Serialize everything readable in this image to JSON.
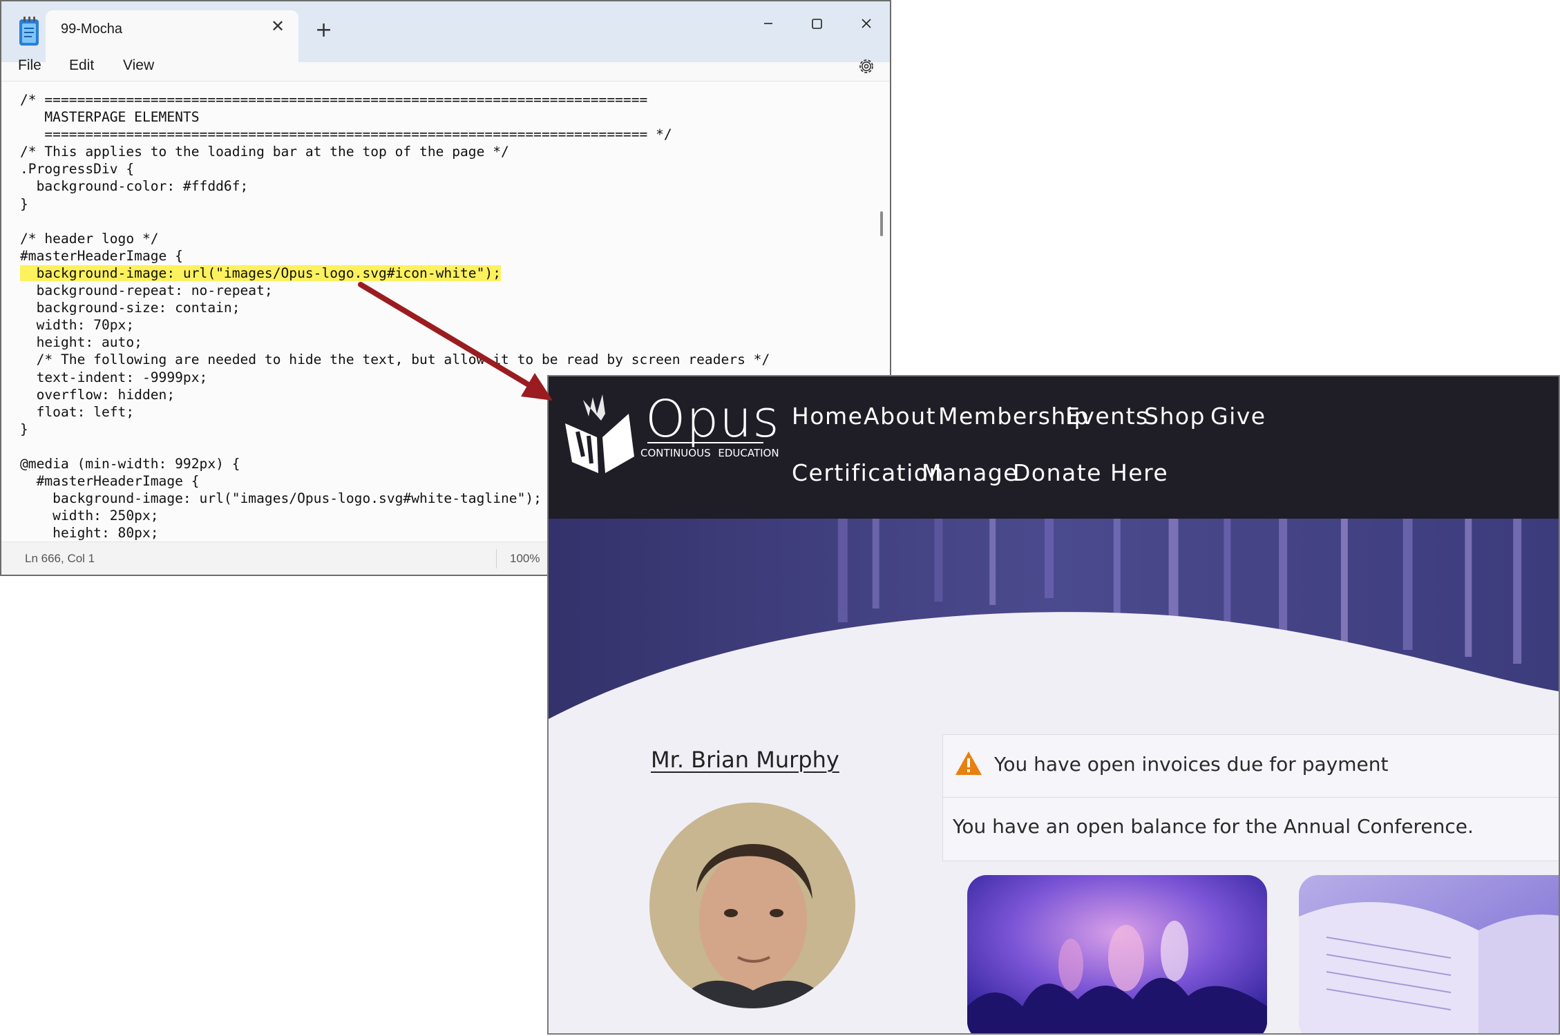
{
  "notepad": {
    "tab_title": "99-Mocha",
    "tab_close_glyph": "✕",
    "new_tab_glyph": "+",
    "menu": {
      "file": "File",
      "edit": "Edit",
      "view": "View"
    },
    "icons": {
      "app": "notepad-icon",
      "gear": "gear-icon",
      "minimize": "minimize-icon",
      "maximize": "maximize-icon",
      "close": "close-icon"
    },
    "code": {
      "before_highlight": "/* ==========================================================================\n   MASTERPAGE ELEMENTS\n   ========================================================================== */\n/* This applies to the loading bar at the top of the page */\n.ProgressDiv {\n  background-color: #ffdd6f;\n}\n\n/* header logo */\n#masterHeaderImage {\n",
      "highlight": "  background-image: url(\"images/Opus-logo.svg#icon-white\");",
      "after_highlight": "\n  background-repeat: no-repeat;\n  background-size: contain;\n  width: 70px;\n  height: auto;\n  /* The following are needed to hide the text, but allow it to be read by screen readers */\n  text-indent: -9999px;\n  overflow: hidden;\n  float: left;\n}\n\n@media (min-width: 992px) {\n  #masterHeaderImage {\n    background-image: url(\"images/Opus-logo.svg#white-tagline\");\n    width: 250px;\n    height: 80px;"
    },
    "status": {
      "position": "Ln 666, Col 1",
      "zoom": "100%"
    }
  },
  "website": {
    "logo_text": "Opus",
    "tagline": "CONTINUOUS EDUCATION",
    "nav": [
      {
        "label": "Home"
      },
      {
        "label": "About"
      },
      {
        "label": "Membership"
      },
      {
        "label": "Events"
      },
      {
        "label": "Shop"
      },
      {
        "label": "Give"
      },
      {
        "label": "Certification"
      },
      {
        "label": "Manage"
      },
      {
        "label": "Donate Here"
      }
    ],
    "welcome_name": "Mr. Brian Murphy",
    "alert": {
      "icon": "warning-icon",
      "title": "You have open invoices due for payment",
      "body": "You have an open balance for the Annual Conference."
    },
    "colors": {
      "header_bg": "#1f1d26",
      "page_bg": "#f1eff6",
      "warning": "#e8800f",
      "highlight": "#fdf15e",
      "arrow": "#9b1c20"
    }
  }
}
